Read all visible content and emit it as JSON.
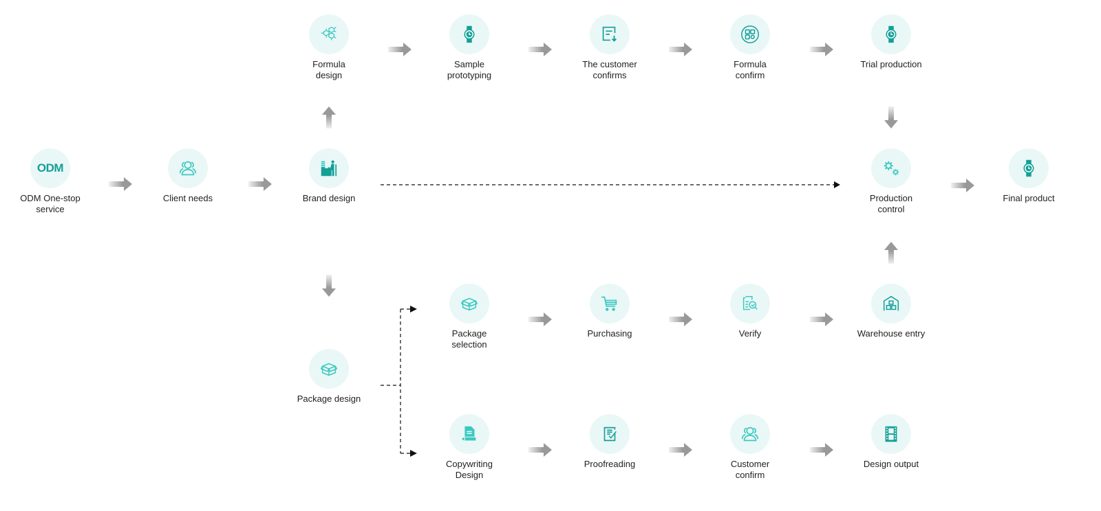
{
  "colors": {
    "icon_primary": "#12a097",
    "icon_light": "#3cc9c0",
    "circle_bg": "#eaf7f7",
    "arrow_gray": "#999999",
    "dashed_line": "#111111"
  },
  "nodes": {
    "odm": {
      "label": "ODM One-stop\nservice",
      "icon_text": "ODM",
      "icon": "odm-text-icon"
    },
    "client_needs": {
      "label": "Client needs",
      "icon": "users-icon"
    },
    "brand_design": {
      "label": "Brand design",
      "icon": "designer-at-desk-icon"
    },
    "formula_design": {
      "label": "Formula\ndesign",
      "icon": "molecule-icon"
    },
    "sample_prototyping": {
      "label": "Sample\nprototyping",
      "icon": "watch-icon"
    },
    "customer_confirms": {
      "label": "The customer\nconfirms",
      "icon": "document-download-icon"
    },
    "formula_confirm": {
      "label": "Formula\nconfirm",
      "icon": "grid-settings-icon"
    },
    "trial_production": {
      "label": "Trial production",
      "icon": "watch-icon"
    },
    "production_control": {
      "label": "Production\ncontrol",
      "icon": "gears-icon"
    },
    "final_product": {
      "label": "Final product",
      "icon": "watch-icon"
    },
    "package_design": {
      "label": "Package design",
      "icon": "box-icon"
    },
    "package_selection": {
      "label": "Package\nselection",
      "icon": "box-icon"
    },
    "purchasing": {
      "label": "Purchasing",
      "icon": "cart-icon"
    },
    "verify": {
      "label": "Verify",
      "icon": "document-inspect-icon"
    },
    "warehouse_entry": {
      "label": "Warehouse entry",
      "icon": "warehouse-icon"
    },
    "copywriting_design": {
      "label": "Copywriting\nDesign",
      "icon": "document-pen-icon"
    },
    "proofreading": {
      "label": "Proofreading",
      "icon": "checklist-icon"
    },
    "customer_confirm": {
      "label": "Customer\nconfirm",
      "icon": "users-icon"
    },
    "design_output": {
      "label": "Design output",
      "icon": "film-icon"
    }
  },
  "edges": [
    {
      "from": "odm",
      "to": "client_needs",
      "style": "solid"
    },
    {
      "from": "client_needs",
      "to": "brand_design",
      "style": "solid"
    },
    {
      "from": "brand_design",
      "to": "formula_design",
      "style": "solid"
    },
    {
      "from": "formula_design",
      "to": "sample_prototyping",
      "style": "solid"
    },
    {
      "from": "sample_prototyping",
      "to": "customer_confirms",
      "style": "solid"
    },
    {
      "from": "customer_confirms",
      "to": "formula_confirm",
      "style": "solid"
    },
    {
      "from": "formula_confirm",
      "to": "trial_production",
      "style": "solid"
    },
    {
      "from": "trial_production",
      "to": "production_control",
      "style": "solid"
    },
    {
      "from": "brand_design",
      "to": "production_control",
      "style": "dashed"
    },
    {
      "from": "production_control",
      "to": "final_product",
      "style": "solid"
    },
    {
      "from": "brand_design",
      "to": "package_design",
      "style": "solid"
    },
    {
      "from": "package_design",
      "to": "package_selection",
      "style": "dashed"
    },
    {
      "from": "package_design",
      "to": "copywriting_design",
      "style": "dashed"
    },
    {
      "from": "package_selection",
      "to": "purchasing",
      "style": "solid"
    },
    {
      "from": "purchasing",
      "to": "verify",
      "style": "solid"
    },
    {
      "from": "verify",
      "to": "warehouse_entry",
      "style": "solid"
    },
    {
      "from": "warehouse_entry",
      "to": "production_control",
      "style": "solid"
    },
    {
      "from": "copywriting_design",
      "to": "proofreading",
      "style": "solid"
    },
    {
      "from": "proofreading",
      "to": "customer_confirm",
      "style": "solid"
    },
    {
      "from": "customer_confirm",
      "to": "design_output",
      "style": "solid"
    }
  ]
}
